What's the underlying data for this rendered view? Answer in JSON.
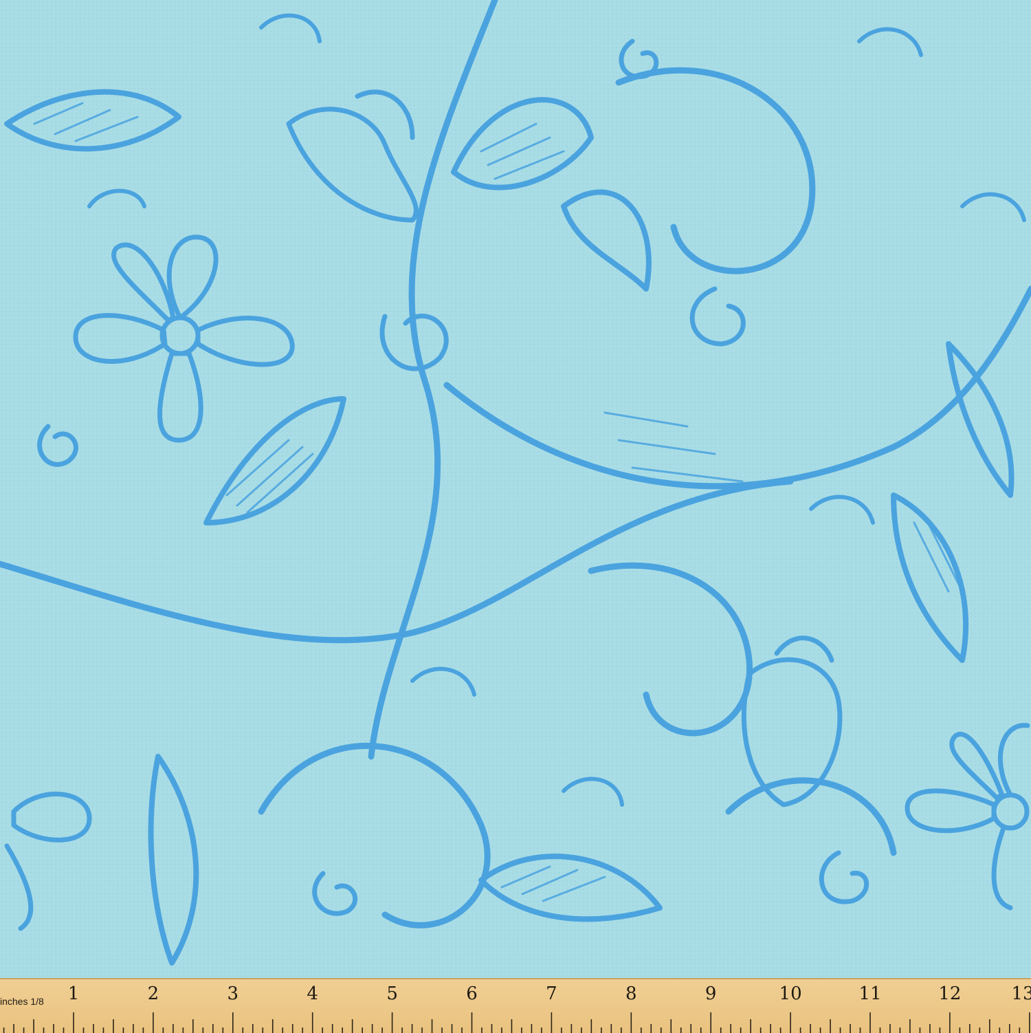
{
  "fabric": {
    "background_color": "#a9dde6",
    "motif_color": "#4aa3de",
    "pattern": "floral-scroll"
  },
  "ruler": {
    "unit_label": "inches 1/8",
    "numbers": [
      "1",
      "2",
      "3",
      "4",
      "5",
      "6",
      "7",
      "8",
      "9",
      "10",
      "11",
      "12",
      "13"
    ]
  }
}
